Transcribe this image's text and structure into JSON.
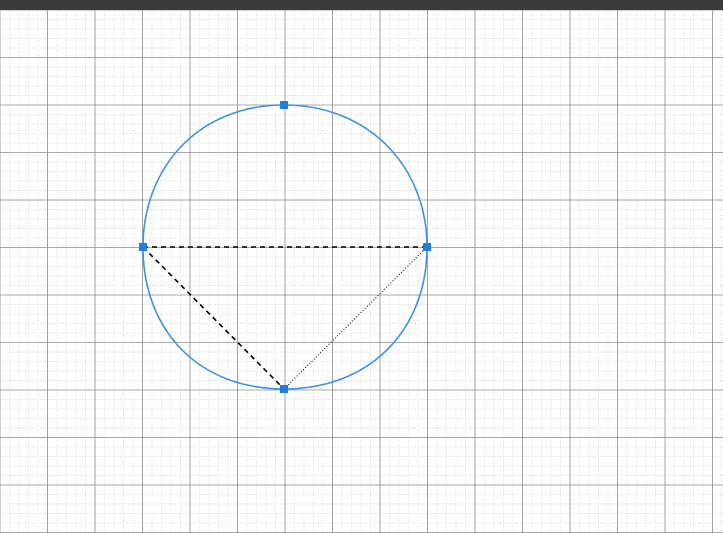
{
  "colors": {
    "topbar": "#3a3a3a",
    "grid_minor": "#d0d0d0",
    "grid_major": "#8c8c8c",
    "curve": "#3b93e3",
    "handle": "#1e7fe0",
    "guide": "#000000"
  },
  "grid": {
    "minor_divisions_per_major": 5,
    "minor_style": "dotted",
    "major_style": "solid"
  },
  "shape": {
    "type": "closed-curve",
    "points": [
      "top",
      "right",
      "bottom",
      "left"
    ],
    "handles": [
      "top",
      "right",
      "bottom",
      "left"
    ]
  },
  "guides": [
    {
      "from": "left",
      "to": "right",
      "style": "dashed"
    },
    {
      "from": "left",
      "to": "bottom",
      "style": "dashed"
    },
    {
      "from": "bottom",
      "to": "right",
      "style": "dotted"
    }
  ]
}
